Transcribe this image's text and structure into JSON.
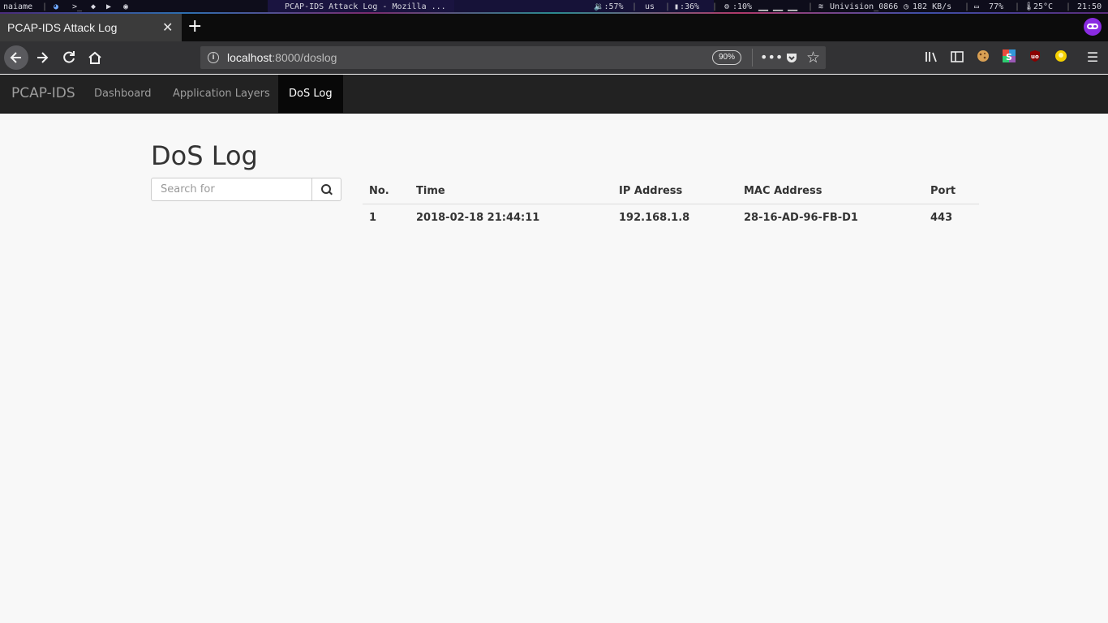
{
  "system_bar": {
    "workspace": "naiame",
    "window_title": "PCAP-IDS Attack Log - Mozilla ...",
    "volume": "🔉:57%",
    "keyboard": "us",
    "memory": ":36%",
    "cpu": ":10%",
    "network": "Univision_0866",
    "speed": "182 KB/s",
    "battery": "77%",
    "temperature": "25°C",
    "clock": "21:50"
  },
  "browser": {
    "tab_title": "PCAP-IDS Attack Log",
    "url_host": "localhost",
    "url_path": ":8000/doslog",
    "zoom": "90%"
  },
  "navbar": {
    "brand": "PCAP-IDS",
    "links": [
      "Dashboard",
      "Application Layers",
      "DoS Log"
    ],
    "active": "DoS Log"
  },
  "page": {
    "title": "DoS Log",
    "search_placeholder": "Search for"
  },
  "table": {
    "headers": [
      "No.",
      "Time",
      "IP Address",
      "MAC Address",
      "Port"
    ],
    "rows": [
      [
        "1",
        "2018-02-18 21:44:11",
        "192.168.1.8",
        "28-16-AD-96-FB-D1",
        "443"
      ]
    ]
  },
  "colors": {
    "navbar_bg": "#222222",
    "active_link_bg": "#080808",
    "page_bg": "#f8f8f8",
    "privacy_icon": "#8a2be2"
  }
}
